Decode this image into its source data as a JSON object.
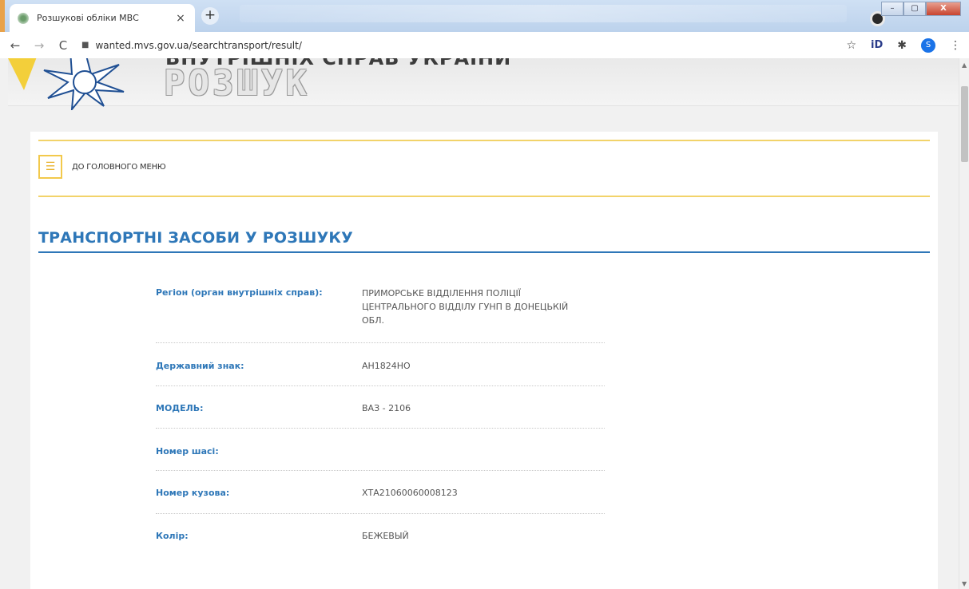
{
  "browser": {
    "tab_title": "Розшукові обліки МВС",
    "tab_close": "×",
    "new_tab": "+",
    "url": "wanted.mvs.gov.ua/searchtransport/result/",
    "profile_initial": "S",
    "extension_label": "iD",
    "window_controls": [
      "–",
      "▢",
      "X"
    ]
  },
  "header": {
    "ministry_text": "ВНУТРІШНІХ СПРАВ УКРАЇНИ",
    "site_title": "РОЗШУК"
  },
  "nav": {
    "main_menu_label": "ДО ГОЛОВНОГО МЕНЮ"
  },
  "section": {
    "title": "ТРАНСПОРТНІ ЗАСОБИ У РОЗШУКУ"
  },
  "record": {
    "fields": [
      {
        "label": "Регіон (орган внутрішніх справ):",
        "value": "ПРИМОРСЬКЕ ВІДДІЛЕННЯ ПОЛІЦІЇ ЦЕНТРАЛЬНОГО ВІДДІЛУ ГУНП В ДОНЕЦЬКІЙ ОБЛ."
      },
      {
        "label": "Державний знак:",
        "value": "АН1824НО"
      },
      {
        "label": "МОДЕЛЬ:",
        "value": "ВАЗ - 2106"
      },
      {
        "label": "Номер шасі:",
        "value": ""
      },
      {
        "label": "Номер кузова:",
        "value": "ХТА21060060008123"
      },
      {
        "label": "Колір:",
        "value": "БЕЖЕВЫЙ"
      }
    ]
  },
  "colors": {
    "accent_blue": "#2e77b8",
    "accent_yellow": "#f2c94c"
  }
}
